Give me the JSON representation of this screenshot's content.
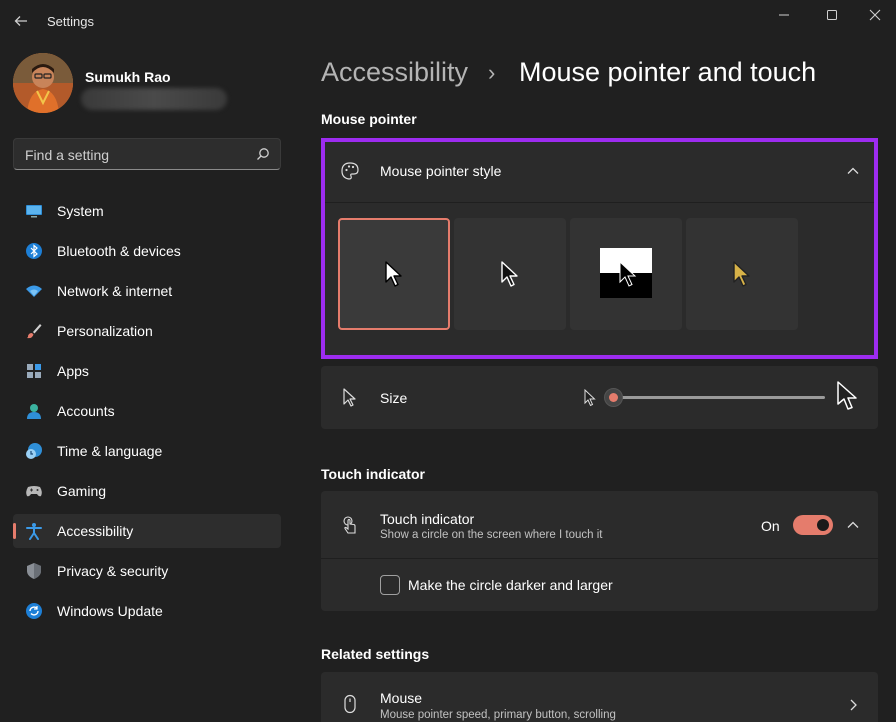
{
  "window": {
    "title": "Settings"
  },
  "user": {
    "name": "Sumukh Rao"
  },
  "search": {
    "placeholder": "Find a setting"
  },
  "sidebar": {
    "items": [
      {
        "label": "System",
        "icon": "system-icon",
        "active": false
      },
      {
        "label": "Bluetooth & devices",
        "icon": "bluetooth-icon",
        "active": false
      },
      {
        "label": "Network & internet",
        "icon": "wifi-icon",
        "active": false
      },
      {
        "label": "Personalization",
        "icon": "brush-icon",
        "active": false
      },
      {
        "label": "Apps",
        "icon": "apps-icon",
        "active": false
      },
      {
        "label": "Accounts",
        "icon": "accounts-icon",
        "active": false
      },
      {
        "label": "Time & language",
        "icon": "globe-clock-icon",
        "active": false
      },
      {
        "label": "Gaming",
        "icon": "gamepad-icon",
        "active": false
      },
      {
        "label": "Accessibility",
        "icon": "accessibility-icon",
        "active": true
      },
      {
        "label": "Privacy & security",
        "icon": "shield-icon",
        "active": false
      },
      {
        "label": "Windows Update",
        "icon": "update-icon",
        "active": false
      }
    ]
  },
  "breadcrumb": {
    "parent": "Accessibility",
    "separator": "›",
    "current": "Mouse pointer and touch"
  },
  "mouse_pointer": {
    "section_title": "Mouse pointer",
    "style_label": "Mouse pointer style",
    "styles": [
      "white",
      "black",
      "inverted",
      "custom"
    ],
    "selected_style": "white",
    "size_label": "Size",
    "size_value": 0
  },
  "touch": {
    "section_title": "Touch indicator",
    "title": "Touch indicator",
    "subtitle": "Show a circle on the screen where I touch it",
    "toggle_state": "On",
    "checkbox_label": "Make the circle darker and larger",
    "checkbox_checked": false
  },
  "related": {
    "section_title": "Related settings",
    "mouse_title": "Mouse",
    "mouse_subtitle": "Mouse pointer speed, primary button, scrolling"
  },
  "colors": {
    "accent": "#e57c6c",
    "highlight": "#9d2cf0",
    "custom_cursor": "#d7b248"
  }
}
